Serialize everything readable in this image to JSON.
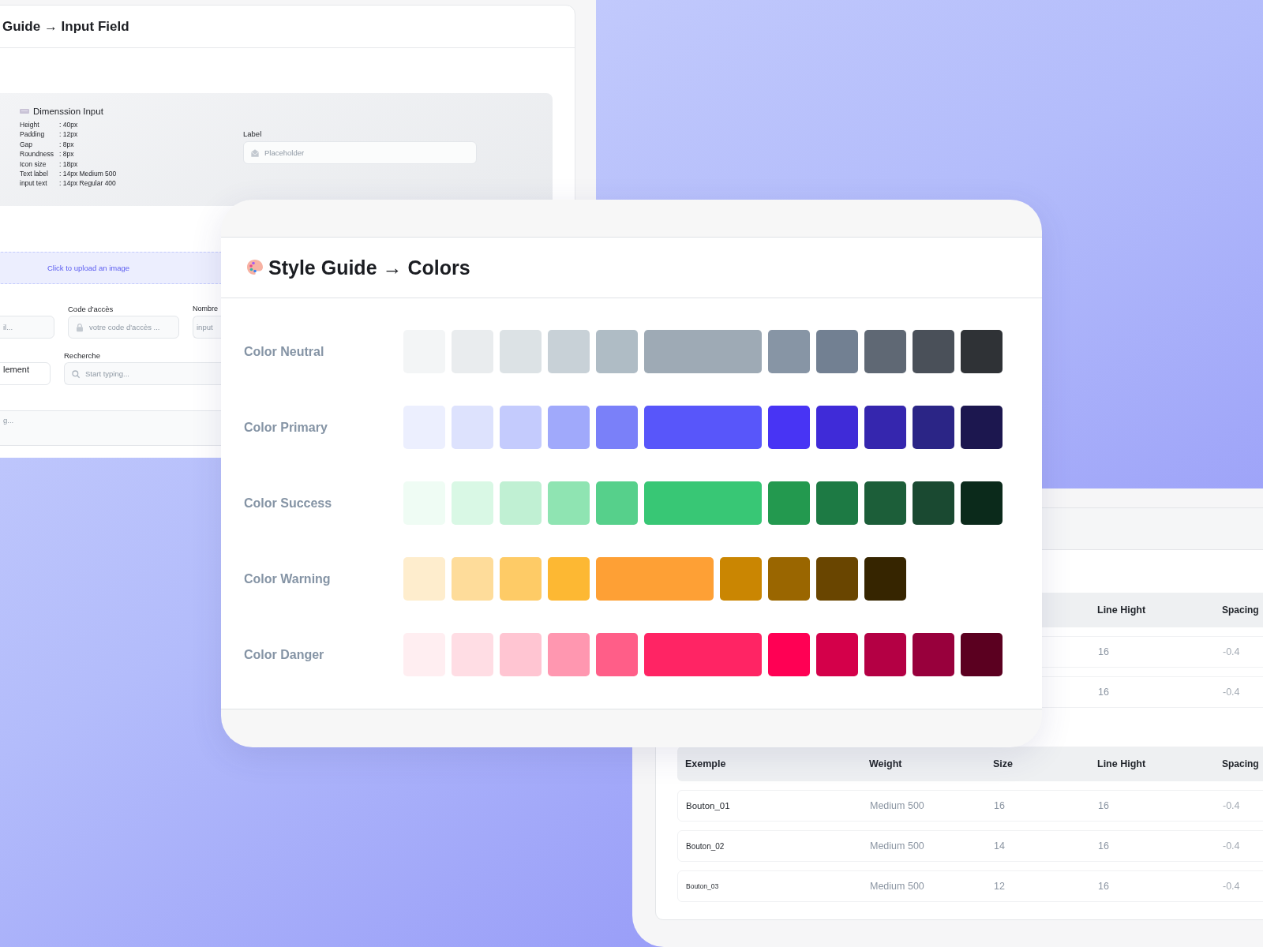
{
  "input_field_card": {
    "title": "Guide → Input Field",
    "spec_panel": {
      "title": "Dimenssion Input",
      "specs": [
        {
          "label": "Height",
          "value": ": 40px"
        },
        {
          "label": "Padding",
          "value": ": 12px"
        },
        {
          "label": "Gap",
          "value": ": 8px"
        },
        {
          "label": "Roundness",
          "value": ": 8px"
        },
        {
          "label": "Icon size",
          "value": ": 18px"
        },
        {
          "label": "Text label",
          "value": ": 14px Medium 500"
        },
        {
          "label": "input text",
          "value": ": 14px Regular 400"
        }
      ]
    },
    "demo_field": {
      "label": "Label",
      "placeholder": "Placeholder"
    },
    "upload_zone": {
      "text": "Click to upload an image"
    },
    "field_rows": [
      [
        {
          "kind": "text",
          "placeholder": "il..."
        },
        {
          "kind": "password",
          "label": "Code d'accès",
          "placeholder": "votre code d'accès ..."
        },
        {
          "kind": "text",
          "label": "Nombre",
          "placeholder": "input"
        }
      ],
      [
        {
          "kind": "text",
          "value": "lement"
        },
        {
          "kind": "search",
          "label": "Recherche",
          "placeholder": "Start typing..."
        }
      ],
      [
        {
          "kind": "text",
          "placeholder": "g..."
        }
      ]
    ]
  },
  "colors_card": {
    "title": "Style Guide → Colors",
    "palettes": [
      {
        "name": "Color Neutral",
        "swatches": [
          {
            "color": "#f3f5f6"
          },
          {
            "color": "#e9ecee"
          },
          {
            "color": "#dce2e5"
          },
          {
            "color": "#c8d1d7"
          },
          {
            "color": "#afbcc5"
          },
          {
            "color": "#9eaab5",
            "kind": "wide"
          },
          {
            "color": "#8795a5"
          },
          {
            "color": "#728092"
          },
          {
            "color": "#5f6874"
          },
          {
            "color": "#4a5059"
          },
          {
            "color": "#2f3236"
          }
        ]
      },
      {
        "name": "Color Primary",
        "swatches": [
          {
            "color": "#eceffe"
          },
          {
            "color": "#dde2fd"
          },
          {
            "color": "#c4cbfd"
          },
          {
            "color": "#a0a9fb"
          },
          {
            "color": "#7a80f9"
          },
          {
            "color": "#5856fa",
            "kind": "wide"
          },
          {
            "color": "#4834f4"
          },
          {
            "color": "#3f2bd8"
          },
          {
            "color": "#3526ae"
          },
          {
            "color": "#2b2586"
          },
          {
            "color": "#1c174f"
          }
        ]
      },
      {
        "name": "Color Success",
        "swatches": [
          {
            "color": "#effcf4"
          },
          {
            "color": "#d9f8e5"
          },
          {
            "color": "#c0f0d3"
          },
          {
            "color": "#8fe4b2"
          },
          {
            "color": "#56d08b"
          },
          {
            "color": "#38c775",
            "kind": "wide"
          },
          {
            "color": "#23994f"
          },
          {
            "color": "#1d7a44"
          },
          {
            "color": "#1c5e39"
          },
          {
            "color": "#1a4931"
          },
          {
            "color": "#0b2a1b"
          }
        ]
      },
      {
        "name": "Color Warning",
        "swatches": [
          {
            "color": "#feedcd"
          },
          {
            "color": "#fedc9a"
          },
          {
            "color": "#fecb66"
          },
          {
            "color": "#fdb833"
          },
          {
            "color": "#fea035",
            "kind": "wide"
          },
          {
            "color": "#ca8602"
          },
          {
            "color": "#9a6600"
          },
          {
            "color": "#694500"
          },
          {
            "color": "#362500"
          }
        ]
      },
      {
        "name": "Color Danger",
        "swatches": [
          {
            "color": "#ffeef1"
          },
          {
            "color": "#ffdde4"
          },
          {
            "color": "#ffc5d2"
          },
          {
            "color": "#ff97b0"
          },
          {
            "color": "#ff5e88"
          },
          {
            "color": "#ff2464",
            "kind": "wide"
          },
          {
            "color": "#ff0054"
          },
          {
            "color": "#d4004a"
          },
          {
            "color": "#b40044"
          },
          {
            "color": "#98003c"
          },
          {
            "color": "#5b0020"
          }
        ]
      }
    ]
  },
  "typography_card": {
    "tables": [
      {
        "columns": [
          "Line Hight",
          "Spacing"
        ],
        "rows": [
          [
            "16",
            "-0.4"
          ],
          [
            "16",
            "-0.4"
          ]
        ]
      },
      {
        "columns": [
          "Exemple",
          "Weight",
          "Size",
          "Line Hight",
          "Spacing"
        ],
        "rows": [
          [
            "Bouton_01",
            "Medium 500",
            "16",
            "16",
            "-0.4"
          ],
          [
            "Bouton_02",
            "Medium 500",
            "14",
            "16",
            "-0.4"
          ],
          [
            "Bouton_03",
            "Medium 500",
            "12",
            "16",
            "-0.4"
          ]
        ]
      }
    ]
  }
}
